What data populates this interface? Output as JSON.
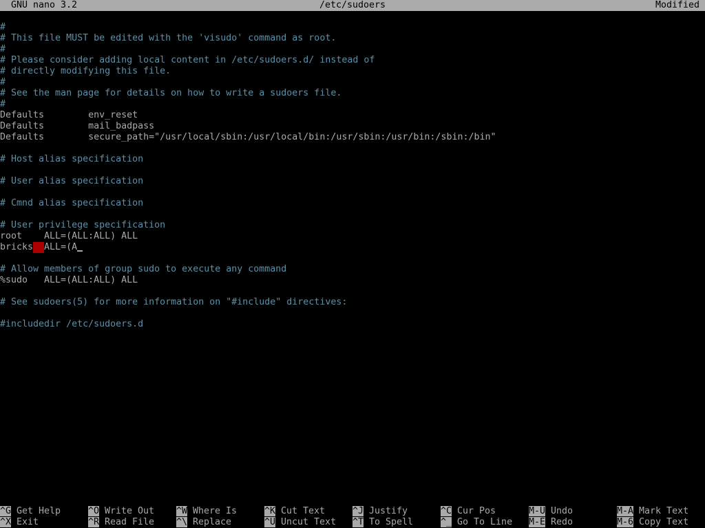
{
  "titlebar": {
    "app": "GNU nano 3.2",
    "file": "/etc/sudoers",
    "status": "Modified"
  },
  "editor": {
    "lines": [
      "#",
      "# This file MUST be edited with the 'visudo' command as root.",
      "#",
      "# Please consider adding local content in /etc/sudoers.d/ instead of",
      "# directly modifying this file.",
      "#",
      "# See the man page for details on how to write a sudoers file.",
      "#",
      "Defaults        env_reset",
      "Defaults        mail_badpass",
      "Defaults        secure_path=\"/usr/local/sbin:/usr/local/bin:/usr/sbin:/usr/bin:/sbin:/bin\"",
      "",
      "# Host alias specification",
      "",
      "# User alias specification",
      "",
      "# Cmnd alias specification",
      "",
      "# User privilege specification",
      "root    ALL=(ALL:ALL) ALL",
      "",
      "",
      "# Allow members of group sudo to execute any command",
      "%sudo   ALL=(ALL:ALL) ALL",
      "",
      "# See sudoers(5) for more information on \"#include\" directives:",
      "",
      "#includedir /etc/sudoers.d"
    ],
    "editing_line": {
      "before": "bricks",
      "after": "ALL=(A"
    }
  },
  "shortcuts": [
    {
      "key": "^G",
      "label": "Get Help"
    },
    {
      "key": "^X",
      "label": "Exit"
    },
    {
      "key": "^O",
      "label": "Write Out"
    },
    {
      "key": "^R",
      "label": "Read File"
    },
    {
      "key": "^W",
      "label": "Where Is"
    },
    {
      "key": "^\\",
      "label": "Replace"
    },
    {
      "key": "^K",
      "label": "Cut Text"
    },
    {
      "key": "^U",
      "label": "Uncut Text"
    },
    {
      "key": "^J",
      "label": "Justify"
    },
    {
      "key": "^T",
      "label": "To Spell"
    },
    {
      "key": "^C",
      "label": "Cur Pos"
    },
    {
      "key": "^_",
      "label": "Go To Line"
    },
    {
      "key": "M-U",
      "label": "Undo"
    },
    {
      "key": "M-E",
      "label": "Redo"
    },
    {
      "key": "M-A",
      "label": "Mark Text"
    },
    {
      "key": "M-6",
      "label": "Copy Text"
    }
  ],
  "colors": {
    "comment": "#5f8fa3",
    "text": "#aaaaaa",
    "highlight_bar": "#aaaaaa",
    "whitespace_error": "#aa0000",
    "background": "#000000"
  }
}
